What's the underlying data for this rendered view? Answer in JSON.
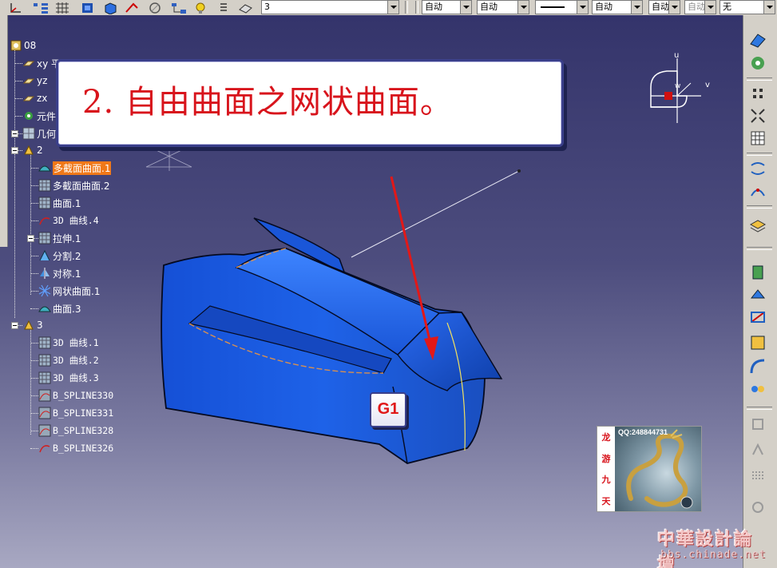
{
  "toolbar": {
    "layer_value": "3",
    "color_value": "自动",
    "transparency_value": "自动",
    "linewidth_value": "自动",
    "linetype_value": "自动",
    "style_value": "自动",
    "disabled_value": "自动",
    "render_value": "无"
  },
  "tree": {
    "root": "08",
    "items": [
      {
        "label": "xy 平面"
      },
      {
        "label": "yz"
      },
      {
        "label": "zx"
      },
      {
        "label": "元件"
      },
      {
        "label": "几何"
      },
      {
        "label": "2"
      },
      {
        "label": "多截面曲面.1"
      },
      {
        "label": "多截面曲面.2"
      },
      {
        "label": "曲面.1"
      },
      {
        "label": "3D 曲线.4"
      },
      {
        "label": "拉伸.1"
      },
      {
        "label": "分割.2"
      },
      {
        "label": "对称.1"
      },
      {
        "label": "网状曲面.1"
      },
      {
        "label": "曲面.3"
      },
      {
        "label": "3"
      },
      {
        "label": "3D 曲线.1"
      },
      {
        "label": "3D 曲线.2"
      },
      {
        "label": "3D 曲线.3"
      },
      {
        "label": "B_SPLINE330"
      },
      {
        "label": "B_SPLINE331"
      },
      {
        "label": "B_SPLINE328"
      },
      {
        "label": "B_SPLINE326"
      }
    ]
  },
  "callout": {
    "text": "2. 自由曲面之网状曲面。"
  },
  "annotation": {
    "g1": "G1"
  },
  "compass": {
    "u": "u",
    "v": "v",
    "w": "w"
  },
  "watermark": {
    "qq": "QQ:248844731",
    "side": [
      "龙",
      "游",
      "九",
      "天"
    ]
  },
  "forum": {
    "title": "中華設計論壇",
    "url": "bbs.chinade.net"
  },
  "colors": {
    "viewport_top": "#34346b",
    "viewport_bottom": "#a8a8c2",
    "surface": "#1e5fd8",
    "selected": "#f07818",
    "callout_text": "#d8141c"
  }
}
